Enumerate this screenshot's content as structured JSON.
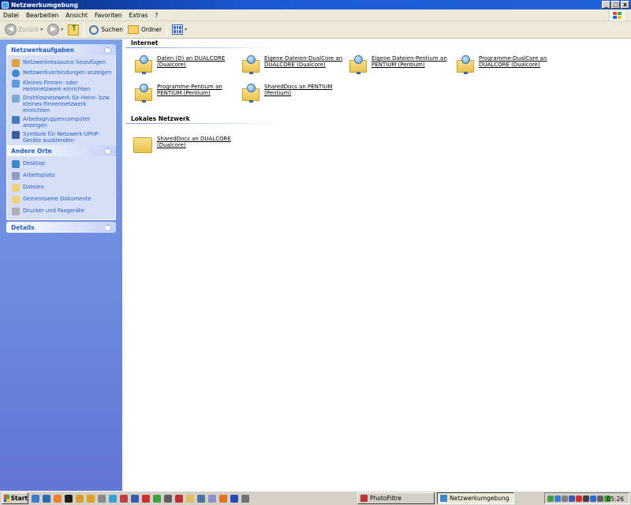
{
  "window": {
    "title": "Netzwerkumgebung",
    "min": "_",
    "max": "□",
    "close": "x"
  },
  "menu": [
    "Datei",
    "Bearbeiten",
    "Ansicht",
    "Favoriten",
    "Extras",
    "?"
  ],
  "toolbar": {
    "back_label": "Zurück",
    "search_label": "Suchen",
    "folders_label": "Ordner"
  },
  "sidebar": {
    "tasks": {
      "title": "Netzwerkaufgaben",
      "items": [
        "Netzwerkressource hinzufügen",
        "Netzwerkverbindungen anzeigen",
        "Kleines Firmen- oder Heimnetzwerk einrichten",
        "Drahtlosnetzwerk für Heim- bzw. kleines Firmennetzwerk einrichten",
        "Arbeitsgruppencomputer anzeigen",
        "Symbole für Netzwerk-UPnP-Geräte ausblenden"
      ]
    },
    "places": {
      "title": "Andere Orte",
      "items": [
        "Desktop",
        "Arbeitsplatz",
        "Dateien",
        "Gemeinsame Dokumente",
        "Drucker und Faxgeräte"
      ]
    },
    "details": {
      "title": "Details"
    }
  },
  "groups": {
    "internet": {
      "title": "Internet",
      "items": [
        "Daten (D) an DUALCORE (Dualcore)",
        "Eigene Dateien-DualCore an DUALCORE (Dualcore)",
        "Eigene Dateien-Pentium an PENTIUM (Pentium)",
        "Programme-DualCore an DUALCORE (Dualcore)",
        "Programme-Pentium an PENTIUM (Pentium)",
        "SharedDocs an PENTIUM (Pentium)"
      ]
    },
    "lan": {
      "title": "Lokales Netzwerk",
      "items": [
        "SharedDocs an DUALCORE (Dualcore)"
      ]
    }
  },
  "taskbar": {
    "start": "Start",
    "tasks": [
      "PhotoFiltre",
      "Netzwerkumgebung"
    ],
    "clock": "05:26"
  }
}
